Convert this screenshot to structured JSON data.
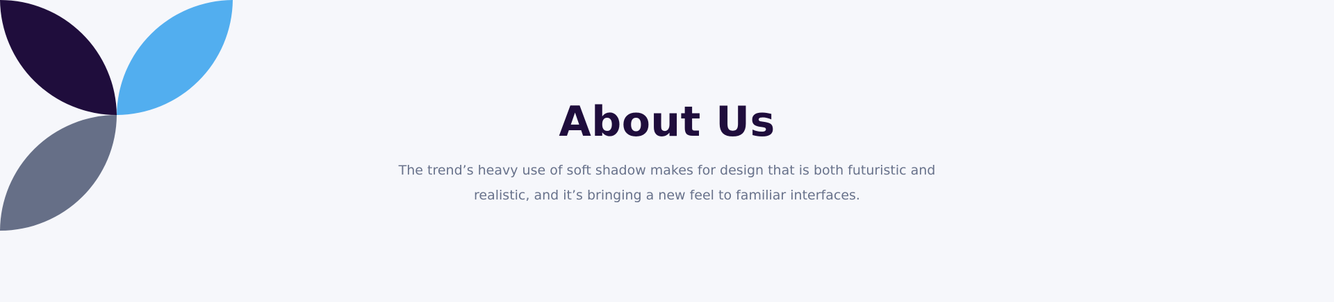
{
  "section": {
    "title": "About Us",
    "description": "The trend’s heavy use of soft shadow makes for design that is both futuristic and realistic, and it’s bringing a new feel to familiar interfaces."
  },
  "colors": {
    "background": "#f6f7fb",
    "title": "#1f0d3c",
    "description": "#68728b",
    "petal_dark": "#1f0d3c",
    "petal_blue": "#52aeef",
    "petal_gray": "#666f87"
  },
  "decoration": {
    "petals": [
      {
        "name": "dark-petal",
        "color_key": "petal_dark"
      },
      {
        "name": "blue-petal",
        "color_key": "petal_blue"
      },
      {
        "name": "gray-petal",
        "color_key": "petal_gray"
      }
    ]
  }
}
